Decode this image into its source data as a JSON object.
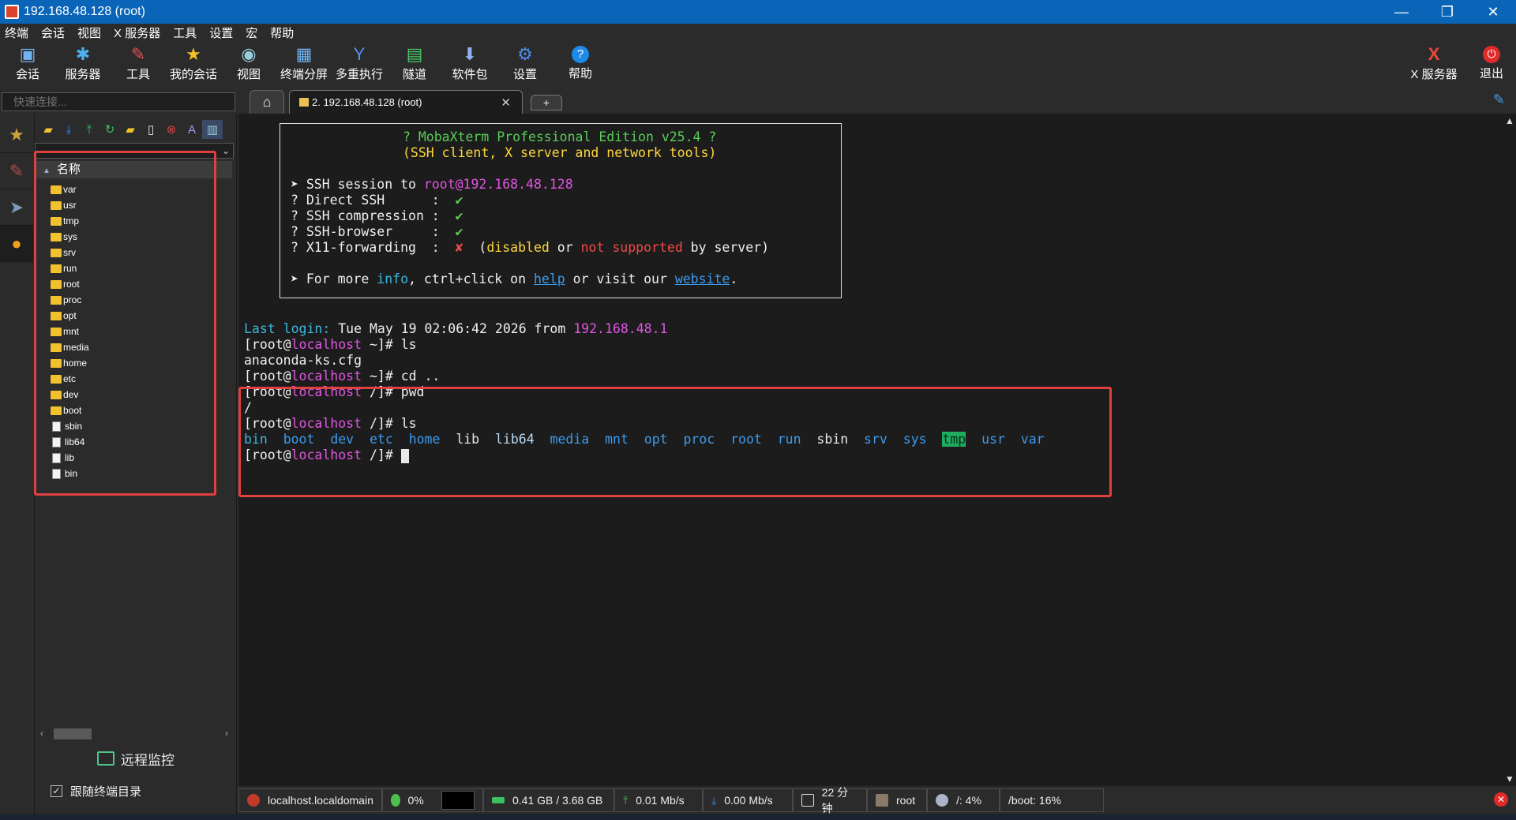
{
  "window": {
    "title": "192.168.48.128 (root)",
    "minimize": "—",
    "restore": "❐",
    "close": "✕"
  },
  "menu": [
    "终端",
    "会话",
    "视图",
    "X 服务器",
    "工具",
    "设置",
    "宏",
    "帮助"
  ],
  "toolbar": [
    {
      "label": "会话",
      "icon": "session-icon"
    },
    {
      "label": "服务器",
      "icon": "servers-icon"
    },
    {
      "label": "工具",
      "icon": "tools-icon"
    },
    {
      "label": "我的会话",
      "icon": "star-icon"
    },
    {
      "label": "视图",
      "icon": "view-icon"
    },
    {
      "label": "终端分屏",
      "icon": "split-icon"
    },
    {
      "label": "多重执行",
      "icon": "multiexec-icon"
    },
    {
      "label": "隧道",
      "icon": "tunnel-icon"
    },
    {
      "label": "软件包",
      "icon": "packages-icon"
    },
    {
      "label": "设置",
      "icon": "settings-icon"
    },
    {
      "label": "帮助",
      "icon": "help-icon"
    }
  ],
  "toolbar_right": [
    {
      "label": "X 服务器",
      "icon": "xserver-icon"
    },
    {
      "label": "退出",
      "icon": "power-icon"
    }
  ],
  "quick_connect": {
    "placeholder": "快速连接..."
  },
  "tabs": {
    "session_label": "2. 192.168.48.128 (root)",
    "add": "+"
  },
  "sidebar": {
    "header": "名称",
    "files": [
      {
        "name": "var",
        "type": "folder"
      },
      {
        "name": "usr",
        "type": "folder"
      },
      {
        "name": "tmp",
        "type": "folder"
      },
      {
        "name": "sys",
        "type": "folder"
      },
      {
        "name": "srv",
        "type": "folder"
      },
      {
        "name": "run",
        "type": "folder"
      },
      {
        "name": "root",
        "type": "folder"
      },
      {
        "name": "proc",
        "type": "folder"
      },
      {
        "name": "opt",
        "type": "folder"
      },
      {
        "name": "mnt",
        "type": "folder"
      },
      {
        "name": "media",
        "type": "folder"
      },
      {
        "name": "home",
        "type": "folder"
      },
      {
        "name": "etc",
        "type": "folder"
      },
      {
        "name": "dev",
        "type": "folder"
      },
      {
        "name": "boot",
        "type": "folder"
      },
      {
        "name": "sbin",
        "type": "link"
      },
      {
        "name": "lib64",
        "type": "link"
      },
      {
        "name": "lib",
        "type": "link"
      },
      {
        "name": "bin",
        "type": "link"
      }
    ],
    "monitor_label": "远程监控",
    "follow_label": "跟随终端目录",
    "follow_checked": true
  },
  "banner": {
    "title1": "? MobaXterm Professional Edition v25.4 ?",
    "title2": "(SSH client, X server and network tools)",
    "ssh_prefix": "➤ SSH session to ",
    "ssh_target": "root@192.168.48.128",
    "opt1": "? Direct SSH      :  ",
    "opt2": "? SSH compression :  ",
    "opt3": "? SSH-browser     :  ",
    "opt4": "? X11-forwarding  :  ",
    "check": "✔",
    "cross": "✘",
    "x11_note_a": "  (",
    "x11_disabled": "disabled",
    "x11_or": " or ",
    "x11_not": "not supported",
    "x11_by": " by server)",
    "more_prefix": "➤ For more ",
    "more_info": "info",
    "more_mid": ", ctrl+click on ",
    "more_help": "help",
    "more_visit": " or visit our ",
    "more_website": "website",
    "more_end": "."
  },
  "terminal": {
    "last_login_label": "Last login:",
    "last_login_date": " Tue May 19 02:06:42 2026 from ",
    "last_login_ip": "192.168.48.1",
    "prompt_open": "[root@",
    "host": "localhost",
    "prompt_home": " ~]# ",
    "prompt_root": " /]# ",
    "cmd_ls": "ls",
    "cmd_cd": "cd ..",
    "cmd_pwd": "pwd",
    "out_ls1": "anaconda-ks.cfg",
    "out_pwd": "/",
    "ls_entries": [
      "bin",
      "boot",
      "dev",
      "etc",
      "home",
      "lib",
      "lib64",
      "media",
      "mnt",
      "opt",
      "proc",
      "root",
      "run",
      "sbin",
      "srv",
      "sys",
      "tmp",
      "usr",
      "var"
    ]
  },
  "status": {
    "host": "localhost.localdomain",
    "cpu": "0%",
    "mem": "0.41 GB / 3.68 GB",
    "up": "0.01 Mb/s",
    "down": "0.00 Mb/s",
    "uptime": "22 分钟",
    "user": "root",
    "disk": "/: 4%",
    "boot": "/boot: 16%"
  }
}
